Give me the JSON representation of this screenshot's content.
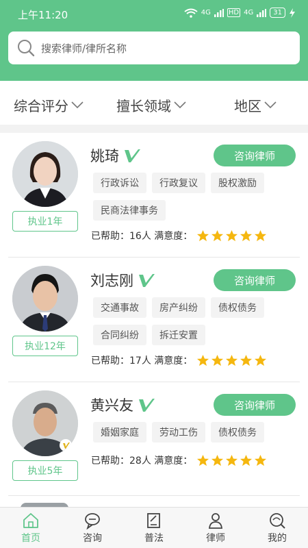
{
  "status_bar": {
    "time": "上午11:20",
    "network_1": "4G",
    "hd": "HD",
    "network_2": "4G",
    "battery": "31"
  },
  "search": {
    "placeholder": "搜索律师/律所名称"
  },
  "filters": [
    {
      "label": "综合评分"
    },
    {
      "label": "擅长领域"
    },
    {
      "label": "地区"
    }
  ],
  "lawyers": [
    {
      "name": "姚琦",
      "years": "执业1年",
      "consult_label": "咨询律师",
      "tags": [
        "行政诉讼",
        "行政复议",
        "股权激励",
        "民商法律事务"
      ],
      "helped_label": "已帮助：16人 满意度：",
      "rating": 5
    },
    {
      "name": "刘志刚",
      "years": "执业12年",
      "consult_label": "咨询律师",
      "tags": [
        "交通事故",
        "房产纠纷",
        "债权债务",
        "合同纠纷",
        "拆迁安置"
      ],
      "helped_label": "已帮助：17人 满意度：",
      "rating": 5
    },
    {
      "name": "黄兴友",
      "years": "执业5年",
      "consult_label": "咨询律师",
      "tags": [
        "婚姻家庭",
        "劳动工伤",
        "债权债务"
      ],
      "helped_label": "已帮助：28人 满意度：",
      "rating": 5
    }
  ],
  "nav": [
    {
      "label": "首页",
      "icon": "home-icon",
      "active": true
    },
    {
      "label": "咨询",
      "icon": "chat-icon",
      "active": false
    },
    {
      "label": "普法",
      "icon": "edit-icon",
      "active": false
    },
    {
      "label": "律师",
      "icon": "lawyer-icon",
      "active": false
    },
    {
      "label": "我的",
      "icon": "profile-search-icon",
      "active": false
    }
  ],
  "colors": {
    "accent": "#5fc58a",
    "star": "#f5b70f"
  }
}
